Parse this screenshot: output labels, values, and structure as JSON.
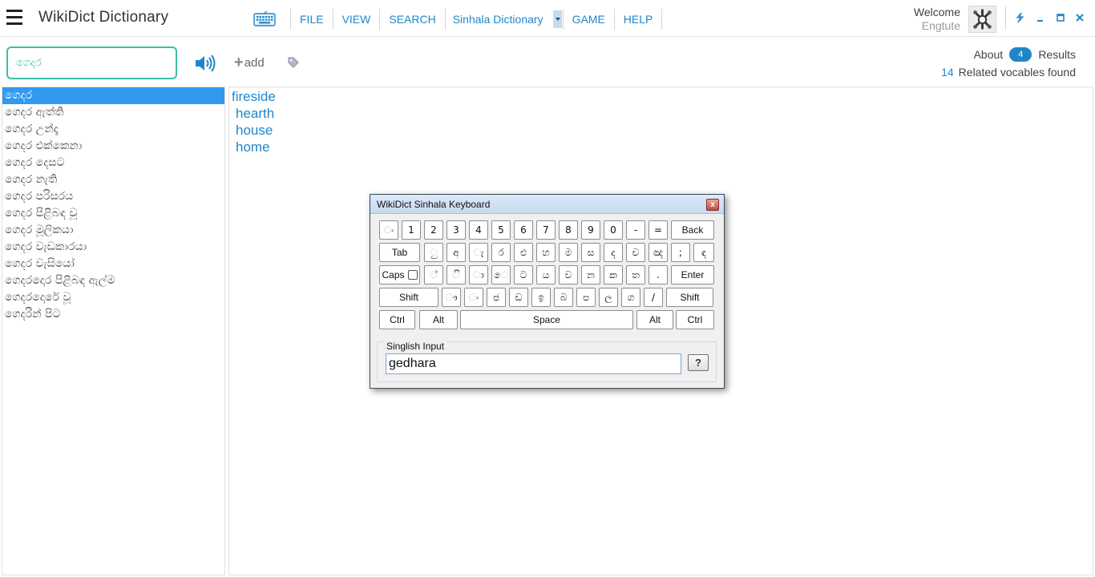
{
  "app": {
    "title": "WikiDict Dictionary"
  },
  "menu": {
    "file": "FILE",
    "view": "VIEW",
    "search": "SEARCH",
    "dictionary": "Sinhala Dictionary",
    "game": "GAME",
    "help": "HELP"
  },
  "user": {
    "welcome": "Welcome",
    "name": "Engtute"
  },
  "search": {
    "value": "ගෙදර",
    "add_label": "add"
  },
  "results": {
    "about": "About",
    "count": "4",
    "results_label": "Results",
    "related_count": "14",
    "related_label": "Related vocables found"
  },
  "word_list": [
    "ගෙදර",
    "ගෙදර ඇත්ති",
    "ගෙදර උන්දෑ",
    "ගෙදර එක්කෙනා",
    "ගෙදර දෙසට",
    "ගෙදර නැති",
    "ගෙදර පරිසරය",
    "ගෙදර පිළිබඳ වූ",
    "ගෙදර මූලිකයා",
    "ගෙදර වැඩකාරයා",
    "ගෙදර වැසියෝ",
    "ගෙදරදොර පිළිබඳ ඇල්ම",
    "ගෙදරදොරේ වූ",
    "ගෙදරින් පිට"
  ],
  "meanings": [
    "fireside",
    "hearth",
    "house",
    "home"
  ],
  "keyboard": {
    "title": "WikiDict Sinhala Keyboard",
    "close_label": "x",
    "rows": [
      [
        "ං",
        "1",
        "2",
        "3",
        "4",
        "5",
        "6",
        "7",
        "8",
        "9",
        "0",
        "-",
        "=",
        "Back"
      ],
      [
        "Tab",
        "ු",
        "අ",
        "ැ",
        "ර",
        "එ",
        "හ",
        "ම",
        "ස",
        "ද",
        "ච",
        "ඤ",
        ";",
        "ඳ"
      ],
      [
        "Caps",
        "්",
        "ි",
        "ා",
        "ෙ",
        "ට",
        "ය",
        "ව",
        "න",
        "ක",
        "ත",
        ".",
        "Enter"
      ],
      [
        "Shift",
        "ෟ",
        "ං",
        "ජ",
        "ඩ",
        "ඉ",
        "බ",
        "ප",
        "ල",
        "ග",
        "/",
        "Shift"
      ],
      [
        "Ctrl",
        "Alt",
        "Space",
        "Alt",
        "Ctrl"
      ]
    ],
    "singlish_label": "Singlish Input",
    "singlish_value": "gedhara",
    "help_label": "?"
  },
  "colors": {
    "accent": "#1f87c8",
    "search_border": "#3bbfa4",
    "selected_row": "#3399ee"
  }
}
